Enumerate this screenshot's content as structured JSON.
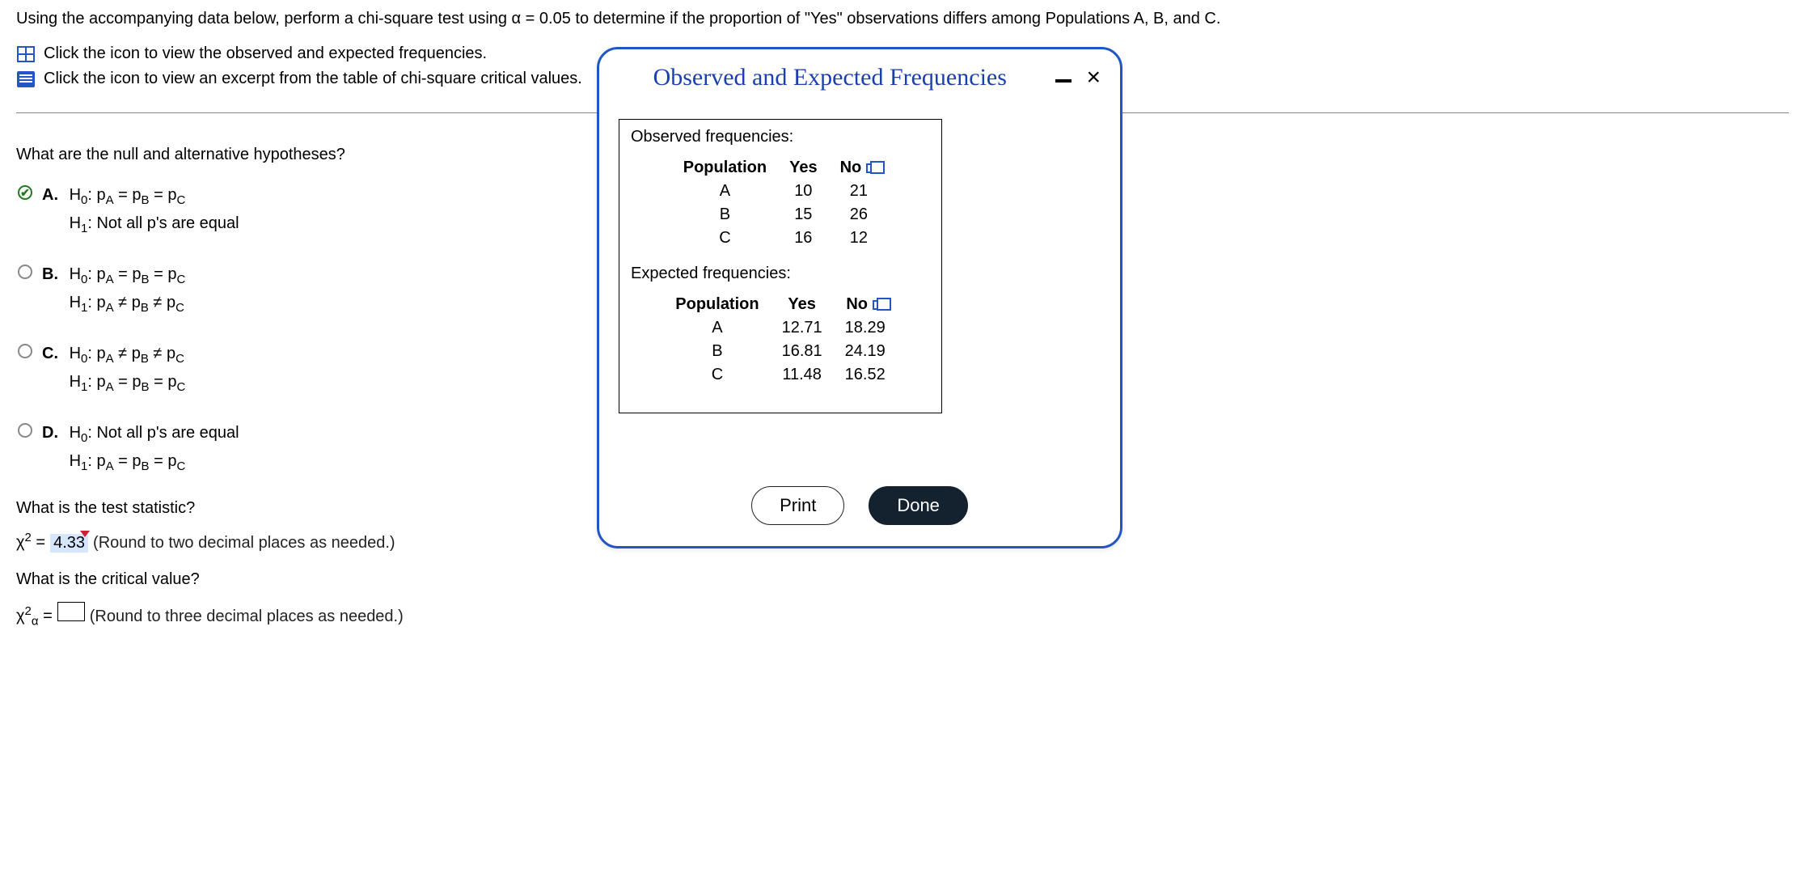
{
  "question": "Using the accompanying data below, perform a chi-square test using α = 0.05 to determine if the proportion of \"Yes\" observations differs among Populations A, B, and C.",
  "link_observed": "Click the icon to view the observed and expected frequencies.",
  "link_critical": "Click the icon to view an excerpt from the table of chi-square critical values.",
  "hyp_prompt": "What are the null and alternative hypotheses?",
  "options": {
    "A": {
      "label": "A.",
      "h0": "H₀: p_A = p_B = p_C",
      "h1": "H₁: Not all p's are equal"
    },
    "B": {
      "label": "B.",
      "h0": "H₀: p_A = p_B = p_C",
      "h1": "H₁: p_A ≠ p_B ≠ p_C"
    },
    "C": {
      "label": "C.",
      "h0": "H₀: p_A ≠ p_B ≠ p_C",
      "h1": "H₁: p_A = p_B = p_C"
    },
    "D": {
      "label": "D.",
      "h0": "H₀: Not all p's are equal",
      "h1": "H₁: p_A = p_B = p_C"
    }
  },
  "selected_option": "A",
  "stat_prompt": "What is the test statistic?",
  "stat_symbol": "χ² =",
  "stat_value": "4.33",
  "stat_hint": "(Round to two decimal places as needed.)",
  "crit_prompt": "What is the critical value?",
  "crit_symbol": "χ²_α =",
  "crit_hint": "(Round to three decimal places as needed.)",
  "modal": {
    "title": "Observed and Expected Frequencies",
    "observed_label": "Observed frequencies:",
    "expected_label": "Expected frequencies:",
    "headers": {
      "pop": "Population",
      "yes": "Yes",
      "no": "No"
    },
    "observed": {
      "A": {
        "yes": "10",
        "no": "21"
      },
      "B": {
        "yes": "15",
        "no": "26"
      },
      "C": {
        "yes": "16",
        "no": "12"
      }
    },
    "expected": {
      "A": {
        "yes": "12.71",
        "no": "18.29"
      },
      "B": {
        "yes": "16.81",
        "no": "24.19"
      },
      "C": {
        "yes": "11.48",
        "no": "16.52"
      }
    },
    "print": "Print",
    "done": "Done"
  },
  "chart_data": {
    "type": "table",
    "title": "Observed and Expected Frequencies",
    "tables": [
      {
        "name": "Observed frequencies",
        "columns": [
          "Population",
          "Yes",
          "No"
        ],
        "rows": [
          [
            "A",
            10,
            21
          ],
          [
            "B",
            15,
            26
          ],
          [
            "C",
            16,
            12
          ]
        ]
      },
      {
        "name": "Expected frequencies",
        "columns": [
          "Population",
          "Yes",
          "No"
        ],
        "rows": [
          [
            "A",
            12.71,
            18.29
          ],
          [
            "B",
            16.81,
            24.19
          ],
          [
            "C",
            11.48,
            16.52
          ]
        ]
      }
    ]
  }
}
